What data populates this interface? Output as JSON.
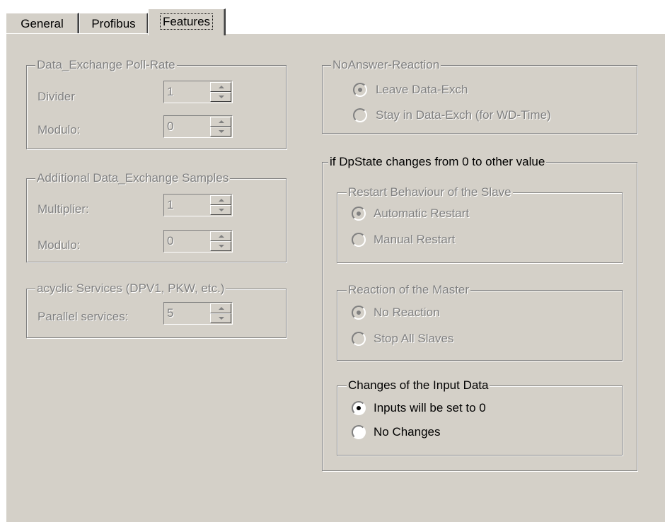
{
  "tabs": [
    {
      "label": "General",
      "active": false
    },
    {
      "label": "Profibus",
      "active": false
    },
    {
      "label": "Features",
      "active": true
    }
  ],
  "poll_rate": {
    "title": "Data_Exchange Poll-Rate",
    "divider_label": "Divider",
    "divider_value": "1",
    "modulo_label": "Modulo:",
    "modulo_value": "0"
  },
  "samples": {
    "title": "Additional Data_Exchange Samples",
    "multiplier_label": "Multiplier:",
    "multiplier_value": "1",
    "modulo_label": "Modulo:",
    "modulo_value": "0"
  },
  "acyclic": {
    "title": "acyclic Services (DPV1, PKW, etc.)",
    "parallel_label": "Parallel services:",
    "parallel_value": "5"
  },
  "no_answer": {
    "title": "NoAnswer-Reaction",
    "options": [
      "Leave Data-Exch",
      "Stay in Data-Exch (for WD-Time)"
    ],
    "selected": 0
  },
  "dpstate": {
    "title": "if DpState changes from 0 to other value",
    "restart": {
      "title": "Restart Behaviour of the Slave",
      "options": [
        "Automatic Restart",
        "Manual Restart"
      ],
      "selected": 0
    },
    "master": {
      "title": "Reaction of the Master",
      "options": [
        "No Reaction",
        "Stop All Slaves"
      ],
      "selected": 0
    },
    "input": {
      "title": "Changes of the Input Data",
      "options": [
        "Inputs will be set to 0",
        "No Changes"
      ],
      "selected": 0
    }
  },
  "colors": {
    "face": "#d4d0c8",
    "disabled_text": "#808080",
    "shadow": "#808080",
    "highlight": "#ffffff"
  }
}
